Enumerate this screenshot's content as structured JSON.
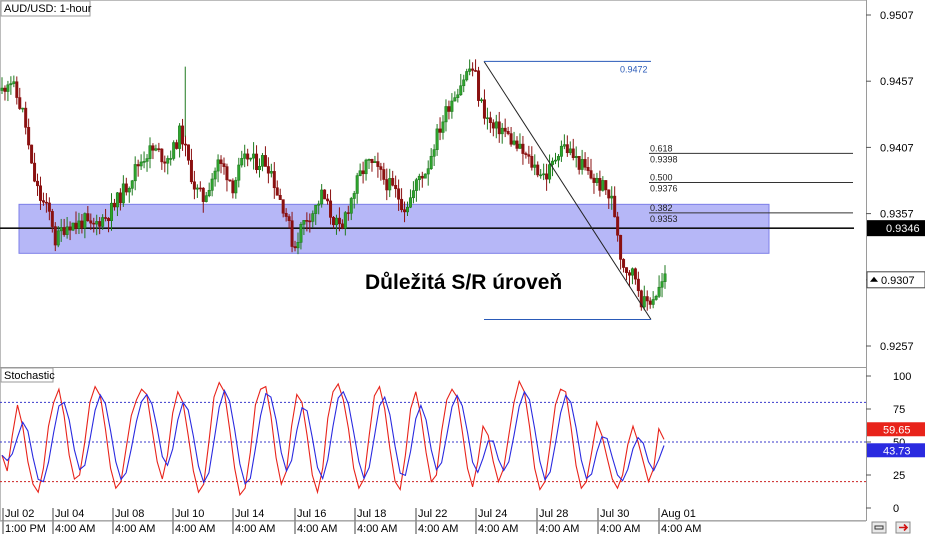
{
  "symbol_label": "AUD/USD: 1-hour",
  "annotation": "Důležitá S/R úroveň",
  "chart_data": [
    {
      "type": "candlestick",
      "title": "AUD/USD: 1-hour",
      "ylim": [
        0.9245,
        0.9525
      ],
      "y_ticks": [
        "0.9507",
        "0.9457",
        "0.9407",
        "0.9357",
        "0.9307",
        "0.9257"
      ],
      "y_tick_values": [
        0.9507,
        0.9457,
        0.9407,
        0.9357,
        0.9307,
        0.9257
      ],
      "x_top_labels": [
        "Jul 02",
        "Jul 04",
        "Jul 08",
        "Jul 10",
        "Jul 14",
        "Jul 16",
        "Jul 18",
        "Jul 22",
        "Jul 24",
        "Jul 28",
        "Jul 30",
        "Aug 01"
      ],
      "x_bottom_labels": [
        "1:00 PM",
        "4:00 AM",
        "4:00 AM",
        "4:00 AM",
        "4:00 AM",
        "4:00 AM",
        "4:00 AM",
        "4:00 AM",
        "4:00 AM",
        "4:00 AM",
        "4:00 AM",
        "4:00 AM"
      ],
      "current_price": "0.9307",
      "sr_level": {
        "label": "0.9346",
        "value": 0.9346,
        "zone": [
          0.9327,
          0.9364
        ]
      },
      "fibonacci": {
        "high": {
          "label": "0.9472",
          "value": 0.9472
        },
        "low": {
          "value": 0.9277
        },
        "levels": [
          {
            "ratio": "0.618",
            "price": "0.9398",
            "value": 0.9398
          },
          {
            "ratio": "0.500",
            "price": "0.9376",
            "value": 0.9376
          },
          {
            "ratio": "0.382",
            "price": "0.9353",
            "value": 0.9353
          }
        ]
      },
      "close_path": [
        [
          0,
          0.945
        ],
        [
          0.5,
          0.946
        ],
        [
          1,
          0.9445
        ],
        [
          1.5,
          0.943
        ],
        [
          2,
          0.939
        ],
        [
          2.5,
          0.937
        ],
        [
          3,
          0.936
        ],
        [
          3.3,
          0.9355
        ],
        [
          3.6,
          0.9335
        ],
        [
          4,
          0.9345
        ],
        [
          4.5,
          0.935
        ],
        [
          5,
          0.9348
        ],
        [
          5.5,
          0.9352
        ],
        [
          6,
          0.9345
        ],
        [
          6.5,
          0.9352
        ],
        [
          7,
          0.9355
        ],
        [
          7.5,
          0.9362
        ],
        [
          8,
          0.9372
        ],
        [
          8.5,
          0.938
        ],
        [
          9,
          0.9392
        ],
        [
          9.5,
          0.94
        ],
        [
          10,
          0.9405
        ],
        [
          10.5,
          0.9403
        ],
        [
          11,
          0.9398
        ],
        [
          11.5,
          0.9405
        ],
        [
          12,
          0.942
        ],
        [
          12.5,
          0.9395
        ],
        [
          13,
          0.9375
        ],
        [
          13.5,
          0.9368
        ],
        [
          14,
          0.9382
        ],
        [
          14.5,
          0.9395
        ],
        [
          15,
          0.939
        ],
        [
          15.5,
          0.9378
        ],
        [
          16,
          0.9392
        ],
        [
          16.5,
          0.94
        ],
        [
          17,
          0.9395
        ],
        [
          17.5,
          0.9398
        ],
        [
          18,
          0.9392
        ],
        [
          18.5,
          0.9372
        ],
        [
          19,
          0.936
        ],
        [
          19.3,
          0.9345
        ],
        [
          19.6,
          0.933
        ],
        [
          20,
          0.9345
        ],
        [
          20.5,
          0.9355
        ],
        [
          21,
          0.936
        ],
        [
          21.5,
          0.9372
        ],
        [
          22,
          0.9358
        ],
        [
          22.5,
          0.9348
        ],
        [
          22.8,
          0.934
        ],
        [
          23,
          0.9355
        ],
        [
          23.5,
          0.937
        ],
        [
          24,
          0.9385
        ],
        [
          24.5,
          0.9395
        ],
        [
          25,
          0.9392
        ],
        [
          25.5,
          0.9385
        ],
        [
          26,
          0.9378
        ],
        [
          26.5,
          0.9372
        ],
        [
          27,
          0.9362
        ],
        [
          27.5,
          0.937
        ],
        [
          28,
          0.9385
        ],
        [
          28.5,
          0.939
        ],
        [
          29,
          0.941
        ],
        [
          29.5,
          0.9425
        ],
        [
          30,
          0.944
        ],
        [
          30.5,
          0.945
        ],
        [
          31,
          0.946
        ],
        [
          31.5,
          0.9468
        ],
        [
          31.8,
          0.946
        ],
        [
          32,
          0.9445
        ],
        [
          32.5,
          0.943
        ],
        [
          33,
          0.942
        ],
        [
          33.5,
          0.9422
        ],
        [
          34,
          0.9415
        ],
        [
          34.5,
          0.9408
        ],
        [
          35,
          0.9402
        ],
        [
          35.5,
          0.9395
        ],
        [
          36,
          0.939
        ],
        [
          36.5,
          0.9385
        ],
        [
          37,
          0.9395
        ],
        [
          37.5,
          0.941
        ],
        [
          38,
          0.9405
        ],
        [
          38.5,
          0.9398
        ],
        [
          39,
          0.9392
        ],
        [
          39.5,
          0.9385
        ],
        [
          40,
          0.938
        ],
        [
          40.5,
          0.9375
        ],
        [
          41,
          0.9365
        ],
        [
          41.3,
          0.9345
        ],
        [
          41.6,
          0.932
        ],
        [
          42,
          0.9315
        ],
        [
          42.5,
          0.931
        ],
        [
          42.8,
          0.9298
        ],
        [
          43,
          0.9288
        ],
        [
          43.5,
          0.9292
        ],
        [
          44,
          0.9298
        ],
        [
          44.5,
          0.9308
        ]
      ]
    },
    {
      "type": "line",
      "title": "Stochastic",
      "ylim": [
        0,
        100
      ],
      "y_ticks": [
        "100",
        "75",
        "50",
        "25",
        "0"
      ],
      "y_tick_values": [
        100,
        75,
        50,
        25,
        0
      ],
      "reference_levels": [
        80,
        50,
        20
      ],
      "series": [
        {
          "label": "59.65",
          "value": 59.65,
          "color": "#e8231a"
        },
        {
          "label": "43.73",
          "value": 43.73,
          "color": "#2a2ae0"
        }
      ],
      "k_path": [
        40,
        28,
        55,
        78,
        62,
        35,
        18,
        12,
        30,
        62,
        80,
        90,
        70,
        40,
        22,
        25,
        50,
        80,
        92,
        85,
        60,
        30,
        15,
        20,
        45,
        70,
        82,
        90,
        86,
        60,
        35,
        22,
        40,
        72,
        88,
        80,
        55,
        28,
        12,
        18,
        50,
        84,
        95,
        88,
        60,
        30,
        10,
        15,
        42,
        78,
        90,
        92,
        70,
        38,
        18,
        28,
        62,
        86,
        80,
        55,
        25,
        12,
        30,
        68,
        88,
        94,
        82,
        60,
        30,
        15,
        22,
        55,
        85,
        92,
        75,
        45,
        20,
        14,
        40,
        75,
        88,
        70,
        42,
        20,
        25,
        58,
        82,
        90,
        84,
        58,
        30,
        16,
        35,
        62,
        55,
        35,
        20,
        30,
        55,
        80,
        96,
        88,
        62,
        30,
        14,
        20,
        48,
        78,
        90,
        88,
        62,
        32,
        15,
        20,
        42,
        65,
        55,
        38,
        22,
        15,
        25,
        48,
        62,
        50,
        35,
        20,
        30,
        60,
        52
      ]
    }
  ],
  "toolbar": {
    "icon_1": "chain-icon",
    "icon_2": "arrow-right-icon"
  },
  "colors": {
    "bull": "#1f7a1f",
    "bear": "#8a1010",
    "zone": "#a9aaf6",
    "sr_line": "#111111",
    "fib": "#333333",
    "fib_high": "#2a5ab8",
    "k": "#e8231a",
    "d": "#2a2ae0"
  }
}
